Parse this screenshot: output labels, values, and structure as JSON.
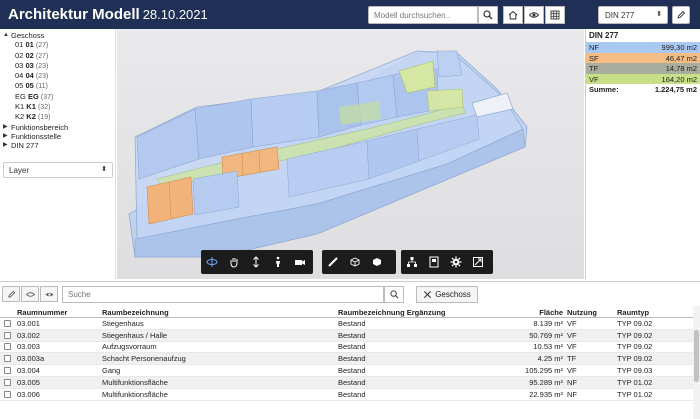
{
  "header": {
    "title": "Architektur Modell",
    "date": "28.10.2021",
    "search_placeholder": "Modell durchsuchen..",
    "din_select": "DIN 277",
    "bg_color": "#1f2f55"
  },
  "tree": {
    "items": [
      {
        "label": "Geschoss",
        "expanded": true,
        "children": [
          {
            "prefix": "01",
            "code": "01",
            "count": "(27)"
          },
          {
            "prefix": "02",
            "code": "02",
            "count": "(27)"
          },
          {
            "prefix": "03",
            "code": "03",
            "count": "(23)"
          },
          {
            "prefix": "04",
            "code": "04",
            "count": "(23)"
          },
          {
            "prefix": "05",
            "code": "05",
            "count": "(11)"
          },
          {
            "prefix": "EG",
            "code": "EG",
            "count": "(37)"
          },
          {
            "prefix": "K1",
            "code": "K1",
            "count": "(32)"
          },
          {
            "prefix": "K2",
            "code": "K2",
            "count": "(19)"
          }
        ]
      },
      {
        "label": "Funktionsbereich",
        "expanded": false
      },
      {
        "label": "Funktionsstelle",
        "expanded": false
      },
      {
        "label": "DIN 277",
        "expanded": false
      }
    ]
  },
  "layer_select": "Layer",
  "summary": {
    "title": "DIN 277",
    "rows": [
      {
        "label": "NF",
        "value": "999,30 m2",
        "color": "#a9c9f3"
      },
      {
        "label": "SF",
        "value": "46,47 m2",
        "color": "#f5bc84"
      },
      {
        "label": "TF",
        "value": "14,78 m2",
        "color": "#a9ad9f"
      },
      {
        "label": "VF",
        "value": "164,20 m2",
        "color": "#c7df87"
      }
    ],
    "sum_label": "Summe:",
    "sum_value": "1.224,75 m2"
  },
  "toolbar_icons": [
    [
      "orbit-icon",
      "pan-hand-icon",
      "zoom-icon",
      "walk-person-icon",
      "camera-icon"
    ],
    [
      "measure-icon",
      "section-box-icon",
      "explode-cube-icon"
    ],
    [
      "model-tree-icon",
      "properties-icon",
      "settings-gear-icon",
      "fullscreen-icon"
    ]
  ],
  "table": {
    "search_placeholder": "Suche",
    "geschoss_button": "Geschoss",
    "columns": [
      "Raumnummer",
      "Raumbezeichnung",
      "Raumbezeichnung Ergänzung",
      "Fläche",
      "Nutzung",
      "Raumtyp"
    ],
    "rows": [
      [
        "03.001",
        "Stiegenhaus",
        "Bestand",
        "8.139 m²",
        "VF",
        "TYP 09.02"
      ],
      [
        "03.002",
        "Stiegenhaus / Halle",
        "Bestand",
        "50.769 m²",
        "VF",
        "TYP 09.02"
      ],
      [
        "03.003",
        "Aufzugsvorraum",
        "Bestand",
        "10.53 m²",
        "VF",
        "TYP 09.02"
      ],
      [
        "03.003a",
        "Schacht Personenaufzug",
        "Bestand",
        "4.25 m²",
        "TF",
        "TYP 09.02"
      ],
      [
        "03.004",
        "Gang",
        "Bestand",
        "105.295 m²",
        "VF",
        "TYP 09.03"
      ],
      [
        "03.005",
        "Multifunktionsfläche",
        "Bestand",
        "95.289 m²",
        "NF",
        "TYP 01.02"
      ],
      [
        "03.006",
        "Multifunktionsfläche",
        "Bestand",
        "22.935 m²",
        "NF",
        "TYP 01.02"
      ]
    ]
  }
}
